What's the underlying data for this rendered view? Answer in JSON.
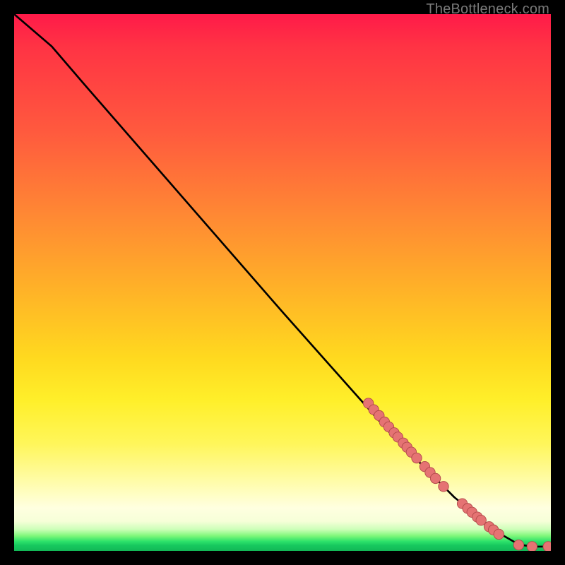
{
  "watermark": "TheBottleneck.com",
  "colors": {
    "background": "#000000",
    "line": "#000000",
    "marker_fill": "#e57373",
    "marker_stroke": "#b24a4a",
    "gradient_top": "#ff1a49",
    "gradient_mid": "#ffd91f",
    "gradient_bottom": "#12b857"
  },
  "chart_data": {
    "type": "line",
    "title": "",
    "xlabel": "",
    "ylabel": "",
    "xlim": [
      0,
      100
    ],
    "ylim": [
      0,
      100
    ],
    "grid": false,
    "legend": false,
    "line_path": [
      {
        "x": 0,
        "y": 100
      },
      {
        "x": 7,
        "y": 94
      },
      {
        "x": 13,
        "y": 87
      },
      {
        "x": 50,
        "y": 44.5
      },
      {
        "x": 70,
        "y": 22
      },
      {
        "x": 82,
        "y": 10
      },
      {
        "x": 90,
        "y": 3.5
      },
      {
        "x": 94,
        "y": 1.2
      },
      {
        "x": 96.5,
        "y": 0.8
      },
      {
        "x": 99.5,
        "y": 0.8
      }
    ],
    "series": [
      {
        "name": "points-upper-cluster",
        "points": [
          {
            "x": 66,
            "y": 27.5
          },
          {
            "x": 67,
            "y": 26.3
          },
          {
            "x": 68,
            "y": 25.2
          },
          {
            "x": 69,
            "y": 24.0
          },
          {
            "x": 69.8,
            "y": 23.1
          },
          {
            "x": 70.8,
            "y": 22.0
          },
          {
            "x": 71.5,
            "y": 21.2
          },
          {
            "x": 72.5,
            "y": 20.1
          },
          {
            "x": 73.2,
            "y": 19.3
          },
          {
            "x": 74.0,
            "y": 18.4
          },
          {
            "x": 75.0,
            "y": 17.3
          },
          {
            "x": 76.5,
            "y": 15.7
          },
          {
            "x": 77.5,
            "y": 14.6
          },
          {
            "x": 78.5,
            "y": 13.5
          },
          {
            "x": 80.0,
            "y": 12.0
          }
        ]
      },
      {
        "name": "points-lower-cluster",
        "points": [
          {
            "x": 83.5,
            "y": 8.8
          },
          {
            "x": 84.5,
            "y": 7.9
          },
          {
            "x": 85.3,
            "y": 7.2
          },
          {
            "x": 86.3,
            "y": 6.3
          },
          {
            "x": 87.0,
            "y": 5.7
          },
          {
            "x": 88.5,
            "y": 4.5
          },
          {
            "x": 89.3,
            "y": 3.9
          },
          {
            "x": 90.3,
            "y": 3.1
          }
        ]
      },
      {
        "name": "points-tail",
        "points": [
          {
            "x": 94.0,
            "y": 1.1
          },
          {
            "x": 96.5,
            "y": 0.8
          },
          {
            "x": 99.5,
            "y": 0.8
          }
        ]
      }
    ]
  }
}
